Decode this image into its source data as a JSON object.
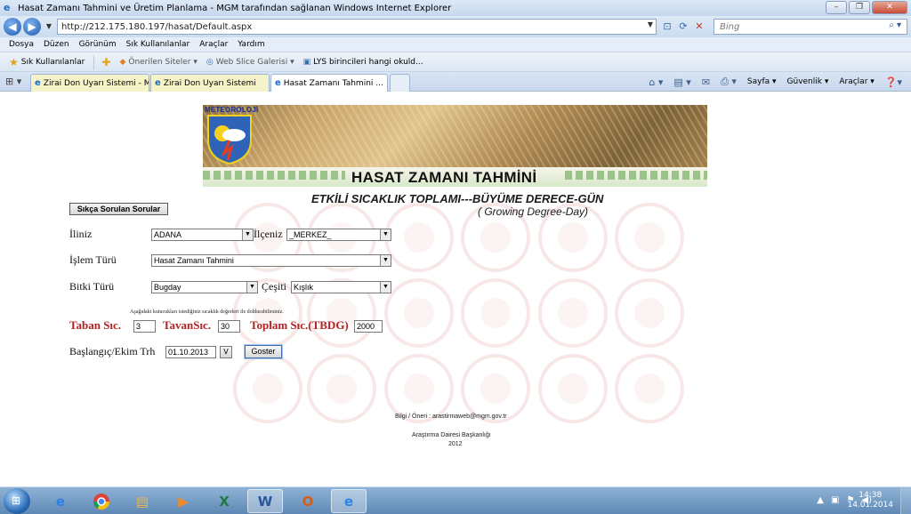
{
  "window": {
    "title": "Hasat Zamanı Tahmini ve Üretim Planlama - MGM tarafından sağlanan Windows Internet Explorer"
  },
  "address": {
    "url": "http://212.175.180.197/hasat/Default.aspx",
    "search_placeholder": "Bing"
  },
  "menu": [
    "Dosya",
    "Düzen",
    "Görünüm",
    "Sık Kullanılanlar",
    "Araçlar",
    "Yardım"
  ],
  "favorites": {
    "label": "Sık Kullanılanlar",
    "items": [
      "Önerilen Siteler ▾",
      "Web Slice Galerisi ▾",
      "LYS birincileri hangi okuld..."
    ]
  },
  "tabs": [
    {
      "label": "Zirai Don Uyarı Sistemi - M...",
      "active": false
    },
    {
      "label": "Zirai Don Uyarı Sistemi",
      "active": false
    },
    {
      "label": "Hasat Zamanı Tahmini ...",
      "active": true
    }
  ],
  "toolbar_tools": [
    "Sayfa ▾",
    "Güvenlik ▾",
    "Araçlar ▾"
  ],
  "page": {
    "banner_logo": "METEOROLOJİ",
    "banner_title": "HASAT ZAMANI TAHMİNİ",
    "subtitle": "ETKİLİ SICAKLIK TOPLAMI---BÜYÜME DERECE-GÜN",
    "subtitle2": "( Growing Degree-Day)",
    "faq_button": "Sıkça Sorulan Sorular",
    "form": {
      "il_label": "İliniz",
      "il_value": "ADANA",
      "ilce_label": "İlçeniz",
      "ilce_value": "_MERKEZ_",
      "islem_label": "İşlem Türü",
      "islem_value": "Hasat Zamanı Tahmini",
      "bitki_label": "Bitki Türü",
      "bitki_value": "Bugday",
      "cesit_label": "Çeşiti",
      "cesit_value": "Kışlık",
      "note": "Aşağıdaki kutucukları istediğiniz sıcaklık değerleri ile doldurabilirsiniz.",
      "taban_label": "Taban Sıc.",
      "taban_value": "3",
      "tavan_label": "TavanSıc.",
      "tavan_value": "30",
      "toplam_label": "Toplam Sıc.(TBDG)",
      "toplam_value": "2000",
      "baslangic_label": "Başlangıç/Ekim Trh",
      "baslangic_value": "01.10.2013",
      "v_button": "V",
      "goster_button": "Goster"
    },
    "footer": {
      "contact": "Bilgi / Öneri : arastirmaweb@mgm.gov.tr",
      "dept": "Araştırma Dairesi Başkanlığı",
      "year": "2012"
    }
  },
  "taskbar": {
    "time": "14:38",
    "date": "14.01.2014"
  },
  "colors": {
    "accent_red": "#b22222",
    "ie_blue": "#1c6cc0"
  }
}
